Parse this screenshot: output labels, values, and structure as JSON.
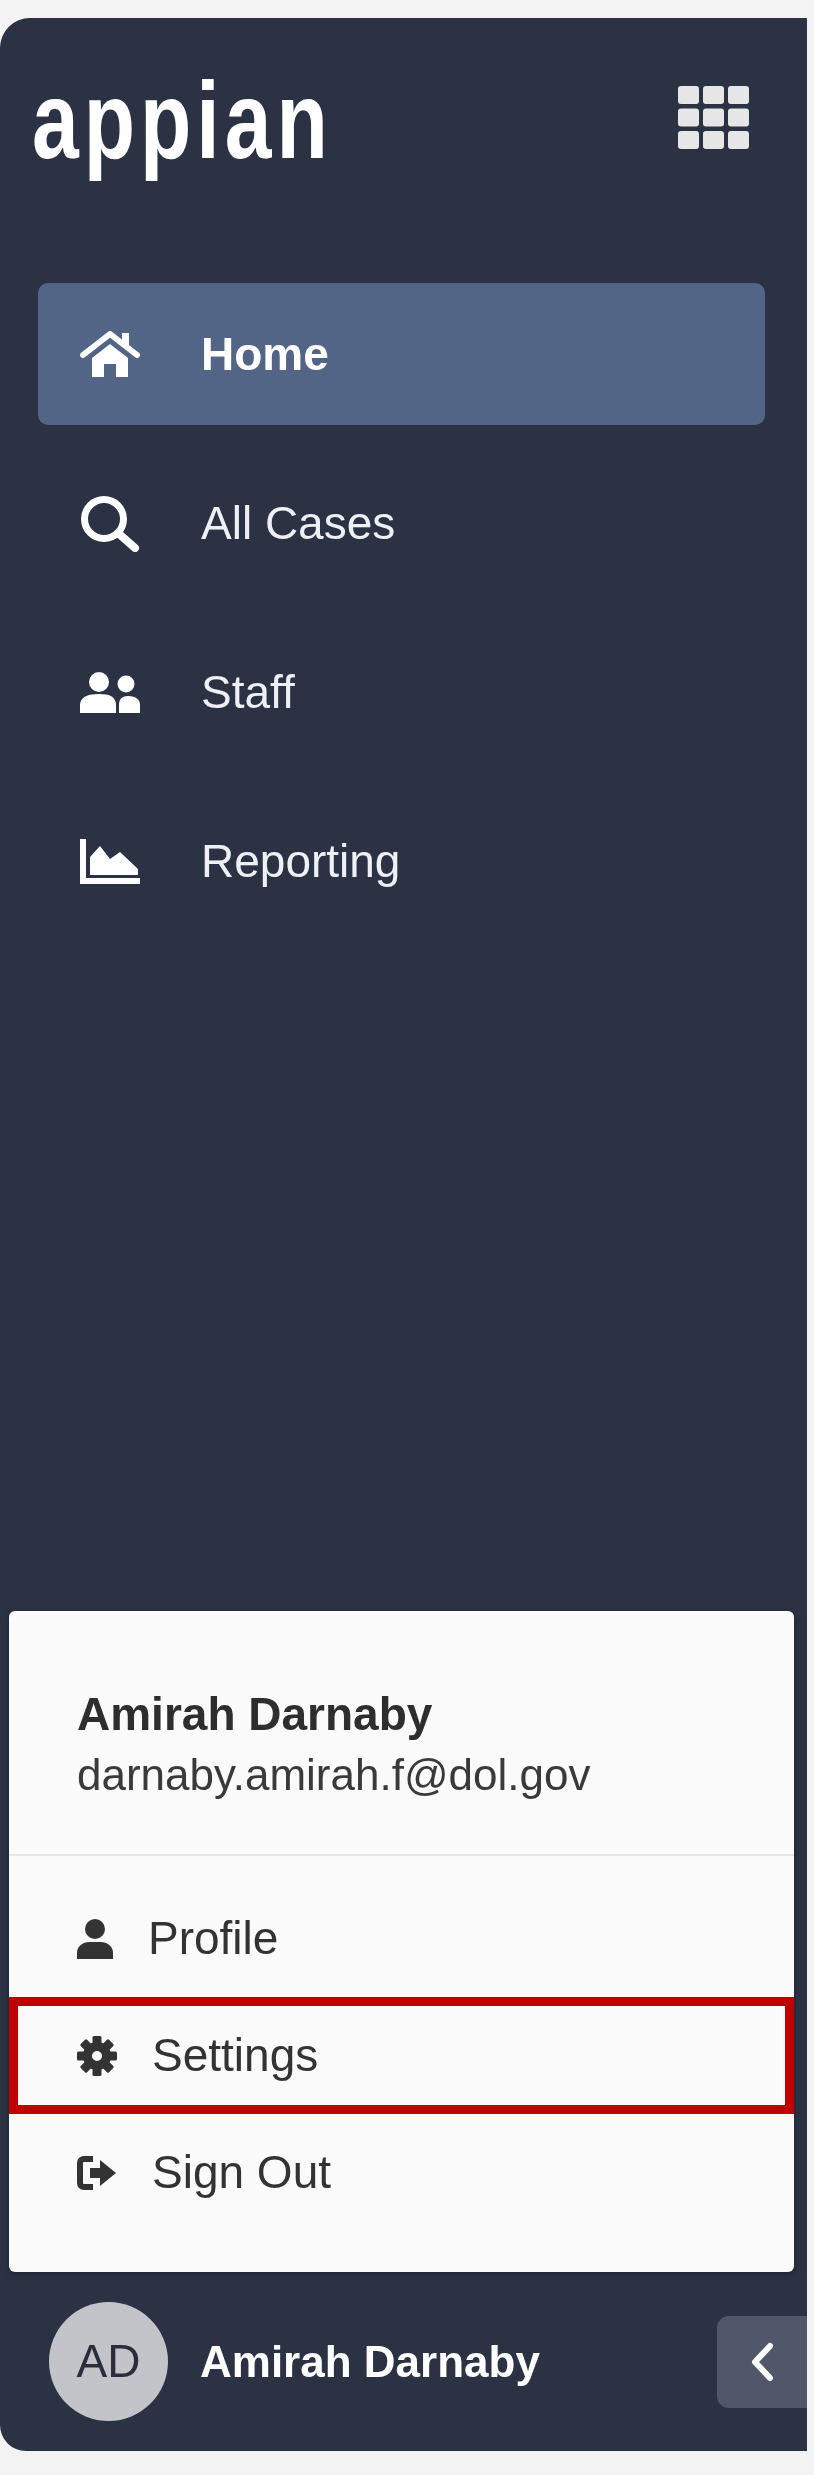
{
  "sidebar": {
    "logo": "appian",
    "nav_items": [
      {
        "label": "Home",
        "kind": "home",
        "selected": true
      },
      {
        "label": "All Cases",
        "kind": "search",
        "selected": false
      },
      {
        "label": "Staff",
        "kind": "staff",
        "selected": false
      },
      {
        "label": "Reporting",
        "kind": "reporting",
        "selected": false
      }
    ]
  },
  "user_menu": {
    "name": "Amirah Darnaby",
    "email": "darnaby.amirah.f@dol.gov",
    "items": [
      {
        "label": "Profile",
        "kind": "profile",
        "highlighted": false
      },
      {
        "label": "Settings",
        "kind": "settings",
        "highlighted": true
      },
      {
        "label": "Sign Out",
        "kind": "sign_out",
        "highlighted": false
      }
    ]
  },
  "footer": {
    "avatar_initials": "AD",
    "user_name": "Amirah Darnaby"
  }
}
